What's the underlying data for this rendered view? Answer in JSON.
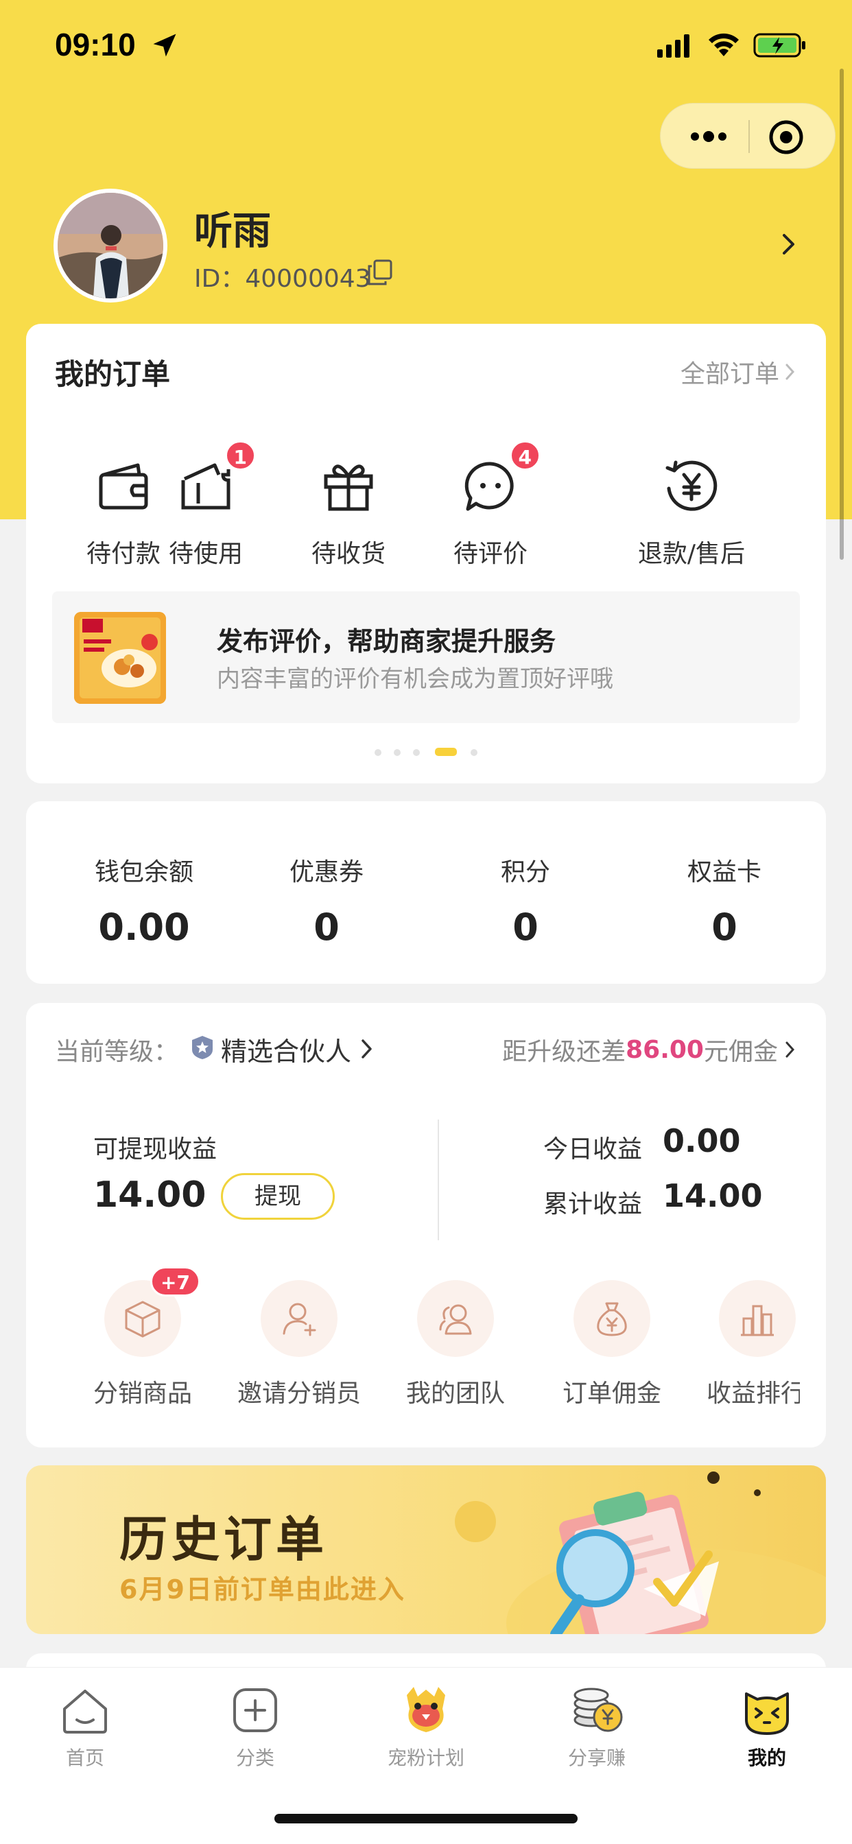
{
  "status_bar": {
    "time": "09:10"
  },
  "profile": {
    "name": "听雨",
    "id_text": "ID：40000043"
  },
  "orders": {
    "title": "我的订单",
    "all_link": "全部订单",
    "items": [
      {
        "label": "待付款",
        "icon": "wallet-icon",
        "badge": ""
      },
      {
        "label": "待使用",
        "icon": "ticket-icon",
        "badge": "1"
      },
      {
        "label": "待收货",
        "icon": "gift-icon",
        "badge": ""
      },
      {
        "label": "待评价",
        "icon": "chat-bubble-icon",
        "badge": "4"
      },
      {
        "label": "退款/售后",
        "icon": "refund-yen-icon",
        "badge": ""
      }
    ],
    "promo": {
      "title": "发布评价，帮助商家提升服务",
      "subtitle": "内容丰富的评价有机会成为置顶好评哦"
    },
    "carousel": {
      "count": 5,
      "active_index": 3
    }
  },
  "wallet": {
    "items": [
      {
        "label": "钱包余额",
        "value": "0.00"
      },
      {
        "label": "优惠券",
        "value": "0"
      },
      {
        "label": "积分",
        "value": "0"
      },
      {
        "label": "权益卡",
        "value": "0"
      }
    ]
  },
  "distribution": {
    "level_label": "当前等级：",
    "level_name": "精选合伙人",
    "upgrade_prefix": "距升级还差",
    "upgrade_amount": "86.00",
    "upgrade_suffix": "元佣金",
    "withdrawable_label": "可提现收益",
    "withdrawable_amount": "14.00",
    "withdraw_button": "提现",
    "today_label": "今日收益",
    "today_value": "0.00",
    "total_label": "累计收益",
    "total_value": "14.00",
    "tools": [
      {
        "label": "分销商品",
        "icon": "box-icon",
        "badge": "+7"
      },
      {
        "label": "邀请分销员",
        "icon": "add-user-icon",
        "badge": ""
      },
      {
        "label": "我的团队",
        "icon": "team-icon",
        "badge": ""
      },
      {
        "label": "订单佣金",
        "icon": "money-bag-icon",
        "badge": ""
      },
      {
        "label": "收益排行",
        "icon": "bar-chart-icon",
        "badge": ""
      }
    ]
  },
  "history_banner": {
    "title": "历史订单",
    "subtitle": "6月9日前订单由此进入"
  },
  "tabbar": {
    "tabs": [
      {
        "label": "首页",
        "icon": "home-icon",
        "active": false
      },
      {
        "label": "分类",
        "icon": "plus-square-icon",
        "active": false
      },
      {
        "label": "宠粉计划",
        "icon": "mascot-icon",
        "active": false
      },
      {
        "label": "分享赚",
        "icon": "coins-icon",
        "active": false
      },
      {
        "label": "我的",
        "icon": "cat-face-icon",
        "active": true
      }
    ]
  },
  "colors": {
    "brand_yellow": "#f8dc4a",
    "badge_red": "#f0455a",
    "highlight_pink": "#e0467f"
  }
}
